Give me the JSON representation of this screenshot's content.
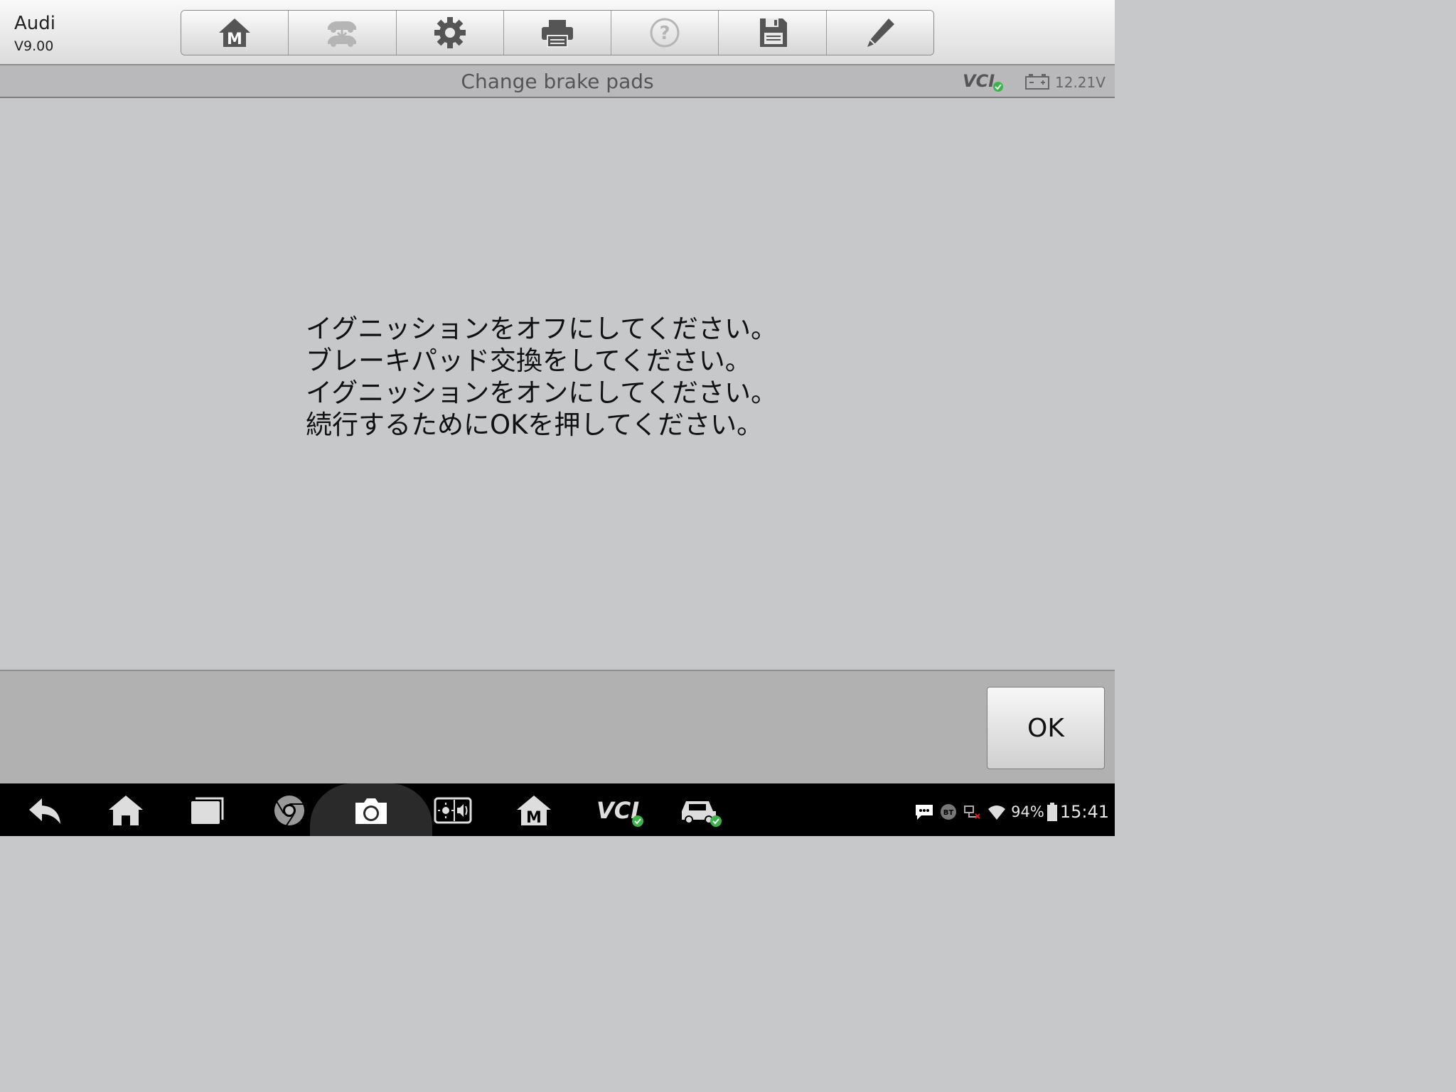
{
  "header": {
    "app_name": "Audi",
    "app_version": "V9.00"
  },
  "toolbar": {
    "buttons": [
      {
        "name": "home-m",
        "icon": "home-m-icon",
        "enabled": true
      },
      {
        "name": "vehicle-swap",
        "icon": "vehicle-swap-icon",
        "enabled": false
      },
      {
        "name": "settings",
        "icon": "gear-icon",
        "enabled": true
      },
      {
        "name": "print",
        "icon": "printer-icon",
        "enabled": true
      },
      {
        "name": "help",
        "icon": "help-icon",
        "enabled": false
      },
      {
        "name": "save",
        "icon": "floppy-icon",
        "enabled": true
      },
      {
        "name": "edit",
        "icon": "pencil-icon",
        "enabled": true
      }
    ]
  },
  "title_bar": {
    "title": "Change brake pads",
    "vcl_label": "VCI",
    "voltage": "12.21V"
  },
  "message": {
    "lines": [
      "イグニッションをオフにしてください。",
      "ブレーキパッド交換をしてください。",
      "イグニッションをオンにしてください。",
      "続行するためにOKを押してください。"
    ]
  },
  "actions": {
    "ok_label": "OK"
  },
  "navbar": {
    "items": [
      "back-icon",
      "home-icon",
      "recents-icon",
      "chrome-icon",
      "camera-icon",
      "brightness-volume-icon",
      "maxisys-home-icon",
      "vci-icon",
      "vehicle-icon"
    ],
    "vci_label": "VCI",
    "status": {
      "bt_label": "BT",
      "battery_percent": "94%",
      "time": "15:41"
    }
  },
  "colors": {
    "background": "#c7c8ca",
    "toolbar": "#e4e4e4",
    "nav_background": "#000000",
    "status_ok": "#3bb54a"
  }
}
